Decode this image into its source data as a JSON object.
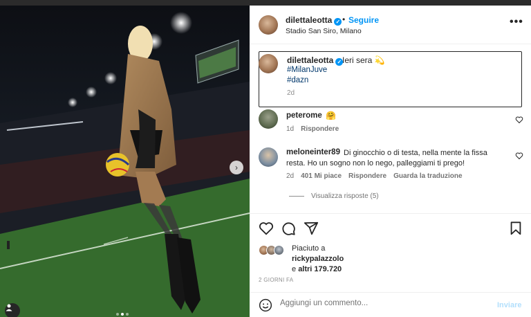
{
  "post": {
    "username": "dilettaleotta",
    "follow_label": "Seguire",
    "separator": "•",
    "location": "Stadio San Siro, Milano",
    "more_label": "•••"
  },
  "caption": {
    "username": "dilettaleotta",
    "text": "Ieri sera 💫",
    "hashtags": [
      "#MilanJuve",
      "#dazn"
    ],
    "time": "2d"
  },
  "comments": [
    {
      "username": "peterome",
      "text": "🤗",
      "time": "1d",
      "reply_label": "Rispondere"
    },
    {
      "username": "meloneinter89",
      "text_line1": "Di ginocchio o di testa, nella mente la fissa",
      "text_line2": "resta. Ho un sogno non lo nego, palleggiami ti prego!",
      "time": "2d",
      "likes_label": "401 Mi piace",
      "reply_label": "Rispondere",
      "translate_label": "Guarda la traduzione",
      "view_replies_label": "Visualizza risposte (5)"
    }
  ],
  "likes": {
    "line1": "Piaciuto a",
    "line2": "rickypalazzolo",
    "line3_prefix": "e ",
    "line3_bold": "altri 179.720"
  },
  "date_label": "2 GIORNI FA",
  "add_comment": {
    "placeholder": "Aggiungi un commento...",
    "send_label": "Inviare"
  },
  "carousel": {
    "slide_count": 3,
    "active_index": 1,
    "next_icon": "chevron-right-icon"
  },
  "colors": {
    "accent": "#0095f6",
    "hashtag": "#00376b",
    "send_disabled": "#b2dffc"
  }
}
